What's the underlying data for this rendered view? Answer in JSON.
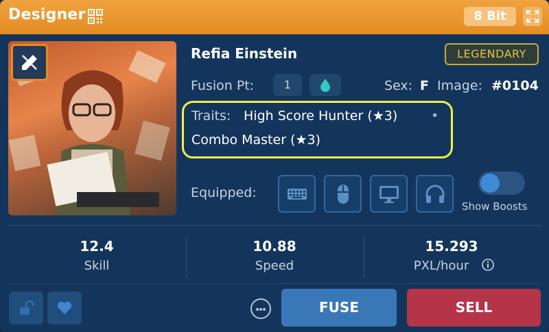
{
  "header": {
    "title": "Designer",
    "qr_icon": "qr-code-icon",
    "badge": "8 Bit",
    "expand_icon": "expand-icon"
  },
  "character": {
    "name": "Refia Einstein",
    "rarity": "LEGENDARY",
    "class_icon": "pencil-ruler-icon",
    "fusion_label": "Fusion Pt:",
    "fusion_value": "1",
    "drop_icon": "water-drop-icon",
    "sex_label": "Sex:",
    "sex_value": "F",
    "image_label": "Image:",
    "image_value": "#0104",
    "traits_label": "Traits:",
    "traits": [
      "High Score Hunter (★3)",
      "Combo Master (★3)"
    ],
    "trait_separator": "•",
    "equipped_label": "Equipped:",
    "equipped": [
      "keyboard-icon",
      "mouse-icon",
      "monitor-icon",
      "headphones-icon"
    ],
    "show_boosts_label": "Show Boosts",
    "show_boosts_on": false
  },
  "stats": [
    {
      "value": "12.4",
      "label": "Skill"
    },
    {
      "value": "10.88",
      "label": "Speed"
    },
    {
      "value": "15.293",
      "label": "PXL/hour"
    }
  ],
  "footer": {
    "lock_icon": "unlock-icon",
    "heart_icon": "heart-icon",
    "more_icon": "more-icon",
    "fuse_label": "FUSE",
    "sell_label": "SELL"
  },
  "colors": {
    "header": "#e48c24",
    "panel": "#14355b",
    "legendary": "#e8c640",
    "fuse": "#3a77b7",
    "sell": "#b53447",
    "highlight": "#f2f04a"
  }
}
